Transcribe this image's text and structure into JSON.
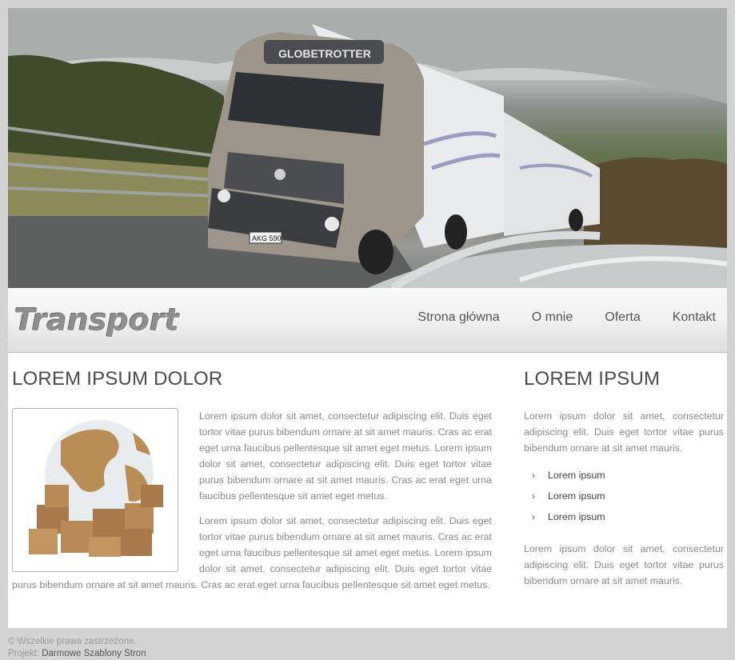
{
  "header": {
    "logo": "Transport",
    "nav": [
      "Strona główna",
      "O mnie",
      "Oferta",
      "Kontakt"
    ]
  },
  "hero": {
    "plate": "AKG 590",
    "brand": "GLOBETROTTER"
  },
  "main": {
    "title": "LOREM IPSUM DOLOR",
    "paragraphs": [
      "Lorem ipsum dolor sit amet, consectetur adipiscing elit. Duis eget tortor vitae purus bibendum ornare at sit amet mauris. Cras ac erat eget urna faucibus pellentesque sit amet eget metus. Lorem ipsum dolor sit amet, consectetur adipiscing elit. Duis eget tortor vitae purus bibendum ornare at sit amet mauris. Cras ac erat eget urna faucibus pellentesque sit amet eget metus.",
      "Lorem ipsum dolor sit amet, consectetur adipiscing elit. Duis eget tortor vitae purus bibendum ornare at sit amet mauris. Cras ac erat eget urna faucibus pellentesque sit amet eget metus. Lorem ipsum dolor sit amet, consectetur adipiscing elit. Duis eget tortor vitae purus bibendum ornare at sit amet mauris. Cras ac erat eget urna faucibus pellentesque sit amet eget metus."
    ]
  },
  "sidebar": {
    "title": "LOREM IPSUM",
    "intro": "Lorem ipsum dolor sit amet, consectetur adipiscing elit. Duis eget tortor vitae purus bibendum ornare at sit amet mauris.",
    "links": [
      "Lorem ipsum",
      "Lorem ipsum",
      "Lorem ipsum"
    ],
    "outro": "Lorem ipsum dolor sit amet, consectetur adipiscing elit. Duis eget tortor vitae purus bibendum ornare at sit amet mauris."
  },
  "footer": {
    "copyright": "© Wszelkie prawa zastrzeżone.",
    "project_label": "Projekt:",
    "project_link": "Darmowe Szablony Stron"
  },
  "colors": {
    "page_bg": "#d3d3d3",
    "heading": "#4b4b4b",
    "body_text": "#8a8a8a",
    "nav_text": "#555555"
  }
}
